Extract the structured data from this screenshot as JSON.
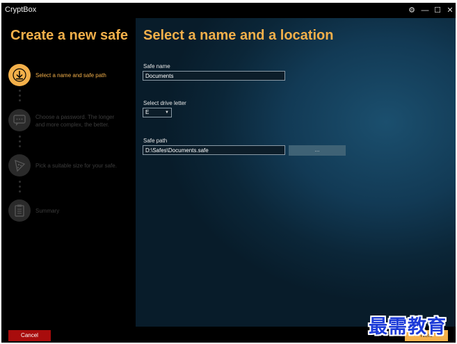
{
  "window": {
    "title": "CryptBox",
    "controls": {
      "settings": "⚙",
      "minimize": "—",
      "maximize": "☐",
      "close": "✕"
    }
  },
  "sidebar": {
    "title": "Create a new safe",
    "steps": [
      {
        "label": "Select a name and safe path",
        "icon": "download-arrow-icon",
        "active": true
      },
      {
        "label": "Choose a password. The longer and more complex, the better.",
        "icon": "chat-bubble-icon",
        "active": false
      },
      {
        "label": "Pick a suitable size for your safe.",
        "icon": "pizza-slice-icon",
        "active": false
      },
      {
        "label": "Summary",
        "icon": "clipboard-list-icon",
        "active": false
      }
    ]
  },
  "main": {
    "title": "Select a name and a location",
    "safe_name": {
      "label": "Safe name",
      "value": "Documents"
    },
    "drive_letter": {
      "label": "Select drive letter",
      "value": "E"
    },
    "safe_path": {
      "label": "Safe path",
      "value": "D:\\Safes\\Documents.safe",
      "browse_label": "..."
    }
  },
  "footer": {
    "cancel_label": "Cancel",
    "next_label": "Next"
  },
  "watermark": {
    "text": "最需教育"
  },
  "colors": {
    "accent": "#f3b04a",
    "cancel": "#a80c0c",
    "background": "#000000",
    "panel_blue": "#123a55"
  }
}
